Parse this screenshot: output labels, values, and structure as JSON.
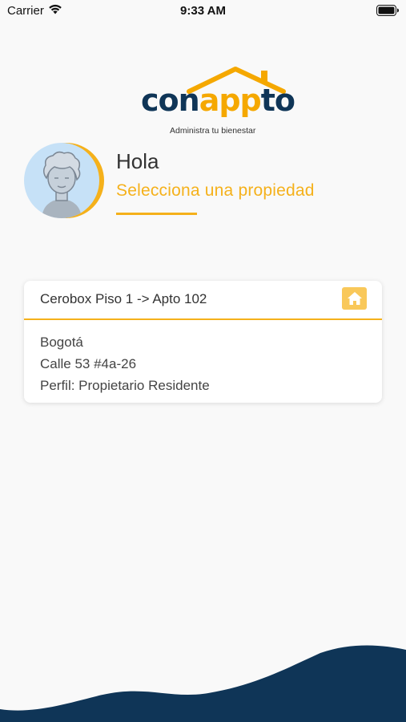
{
  "status_bar": {
    "carrier": "Carrier",
    "time": "9:33 AM"
  },
  "logo": {
    "word_left": "con",
    "word_mid": "app",
    "word_right": "to",
    "tagline": "Administra tu bienestar"
  },
  "greeting": {
    "hello": "Hola",
    "subtitle": "Selecciona una propiedad"
  },
  "property_card": {
    "title": "Cerobox Piso 1 -> Apto 102",
    "city": "Bogotá",
    "address": "Calle 53 #4a-26",
    "profile": "Perfil: Propietario Residente",
    "icon": "home-icon"
  },
  "colors": {
    "accent": "#f5b11b",
    "brand_dark": "#0f3557",
    "wave": "#0f3557"
  }
}
